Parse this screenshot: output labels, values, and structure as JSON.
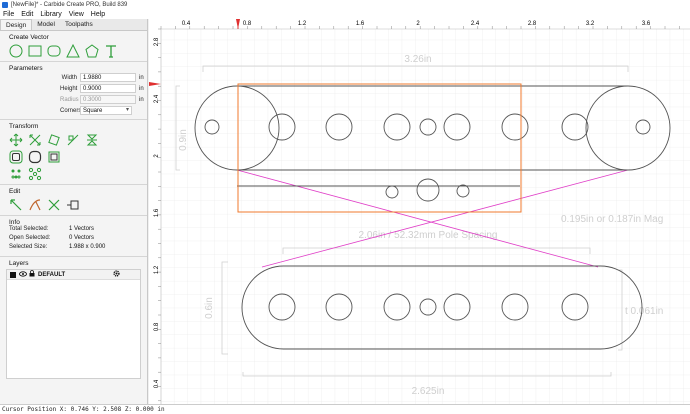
{
  "window": {
    "title": "[NewFile]* - Carbide Create PRO, Build 839"
  },
  "menu": {
    "items": [
      "File",
      "Edit",
      "Library",
      "View",
      "Help"
    ]
  },
  "tabs": [
    "Design",
    "Model",
    "Toolpaths"
  ],
  "create_vector": {
    "heading": "Create Vector",
    "icons": [
      "circle-icon",
      "rectangle-icon",
      "ellipse-icon",
      "polygon-icon",
      "pentagon-icon",
      "text-icon"
    ]
  },
  "parameters": {
    "heading": "Parameters",
    "width_label": "Width",
    "width_value": "1.9880",
    "width_unit": "in",
    "height_label": "Height",
    "height_value": "0.9000",
    "height_unit": "in",
    "radius_label": "Radius",
    "radius_value": "0.3000",
    "radius_unit": "in",
    "corners_label": "Corners",
    "corners_value": "Square"
  },
  "transform": {
    "heading": "Transform"
  },
  "edit": {
    "heading": "Edit"
  },
  "info": {
    "heading": "Info",
    "total_selected_label": "Total Selected:",
    "total_selected_value": "1 Vectors",
    "open_selected_label": "Open Selected:",
    "open_selected_value": "0 Vectors",
    "selected_size_label": "Selected Size:",
    "selected_size_value": "1.988 x 0.900"
  },
  "layers": {
    "heading": "Layers",
    "items": [
      {
        "name": "DEFAULT",
        "color": "#111111"
      }
    ]
  },
  "rulers": {
    "top": [
      "0.4",
      "0.8",
      "1.2",
      "1.6",
      "2",
      "2.4",
      "2.8",
      "3.2",
      "3.6"
    ],
    "left": [
      "2.8",
      "2.4",
      "2",
      "1.6",
      "1.2",
      "0.8",
      "0.4"
    ]
  },
  "annotations": {
    "top_width": "3.26in",
    "top_height": "0.9in",
    "pole_spacing": "2.06in / 52.32mm Pole Spacing",
    "mag_note": "0.195in or 0.187in Mag",
    "bottom_height": "0.6in",
    "bottom_side": "t 0.061in",
    "bottom_width": "2.625in"
  },
  "colors": {
    "selection": "#f07a2e",
    "crossing": "#e040c8",
    "outline": "#555555",
    "dim": "#cfcfcf"
  },
  "status": {
    "cursor": "Cursor Position X: 0.746 Y: 2.508 Z: 0.000 in"
  }
}
